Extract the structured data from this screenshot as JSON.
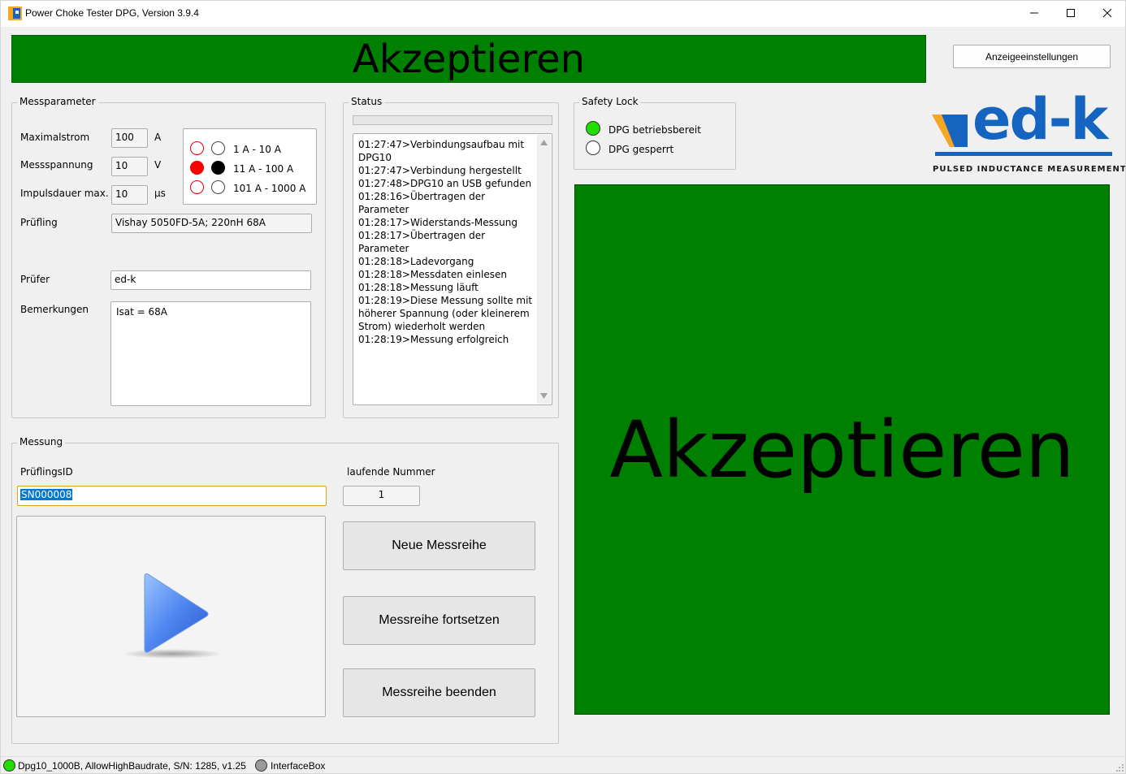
{
  "window": {
    "title": "Power Choke Tester DPG, Version 3.9.4"
  },
  "colors": {
    "accept_green": "#008000",
    "led_green": "#22dd00",
    "radio_red": "#ff0000",
    "logo_blue": "#1565c0",
    "logo_orange": "#f5a623"
  },
  "banner": {
    "text": "Akzeptieren"
  },
  "toolbar": {
    "display_settings_label": "Anzeigeeinstellungen"
  },
  "messparameter": {
    "legend": "Messparameter",
    "max_current_label": "Maximalstrom",
    "max_current_value": "100",
    "max_current_unit": "A",
    "voltage_label": "Messspannung",
    "voltage_value": "10",
    "voltage_unit": "V",
    "pulse_label": "Impulsdauer max.",
    "pulse_value": "10",
    "pulse_unit": "µs",
    "ranges": [
      {
        "label": "1 A - 10 A",
        "active": false
      },
      {
        "label": "11 A - 100 A",
        "active": true
      },
      {
        "label": "101 A - 1000 A",
        "active": false
      }
    ],
    "dut_label": "Prüfling",
    "dut_value": "Vishay 5050FD-5A; 220nH 68A",
    "tester_label": "Prüfer",
    "tester_value": "ed-k",
    "remarks_label": "Bemerkungen",
    "remarks_value": "Isat = 68A"
  },
  "status": {
    "legend": "Status",
    "progress_fraction": 0,
    "log": [
      "01:27:47>Verbindungsaufbau mit DPG10",
      "01:27:47>Verbindung hergestellt",
      "01:27:48>DPG10 an USB gefunden",
      "01:28:16>Übertragen der Parameter",
      "01:28:17>Widerstands-Messung",
      "01:28:17>Übertragen der Parameter",
      "01:28:18>Ladevorgang",
      "01:28:18>Messdaten einlesen",
      "01:28:18>Messung läuft",
      "01:28:19>Diese Messung sollte mit höherer Spannung (oder kleinerem Strom) wiederholt werden",
      "01:28:19>Messung erfolgreich"
    ]
  },
  "safety_lock": {
    "legend": "Safety Lock",
    "ready_label": "DPG betriebsbereit",
    "locked_label": "DPG gesperrt"
  },
  "logo": {
    "text": "ed-k",
    "tagline": "PULSED INDUCTANCE MEASUREMENT"
  },
  "result_panel": {
    "text": "Akzeptieren"
  },
  "messung": {
    "legend": "Messung",
    "id_label": "PrüflingsID",
    "id_value": "SN000008",
    "number_label": "laufende Nummer",
    "number_value": "1",
    "new_series_label": "Neue Messreihe",
    "continue_series_label": "Messreihe fortsetzen",
    "end_series_label": "Messreihe beenden"
  },
  "statusbar": {
    "device_text": "Dpg10_1000B, AllowHighBaudrate, S/N: 1285, v1.25",
    "interface_text": "InterfaceBox"
  }
}
